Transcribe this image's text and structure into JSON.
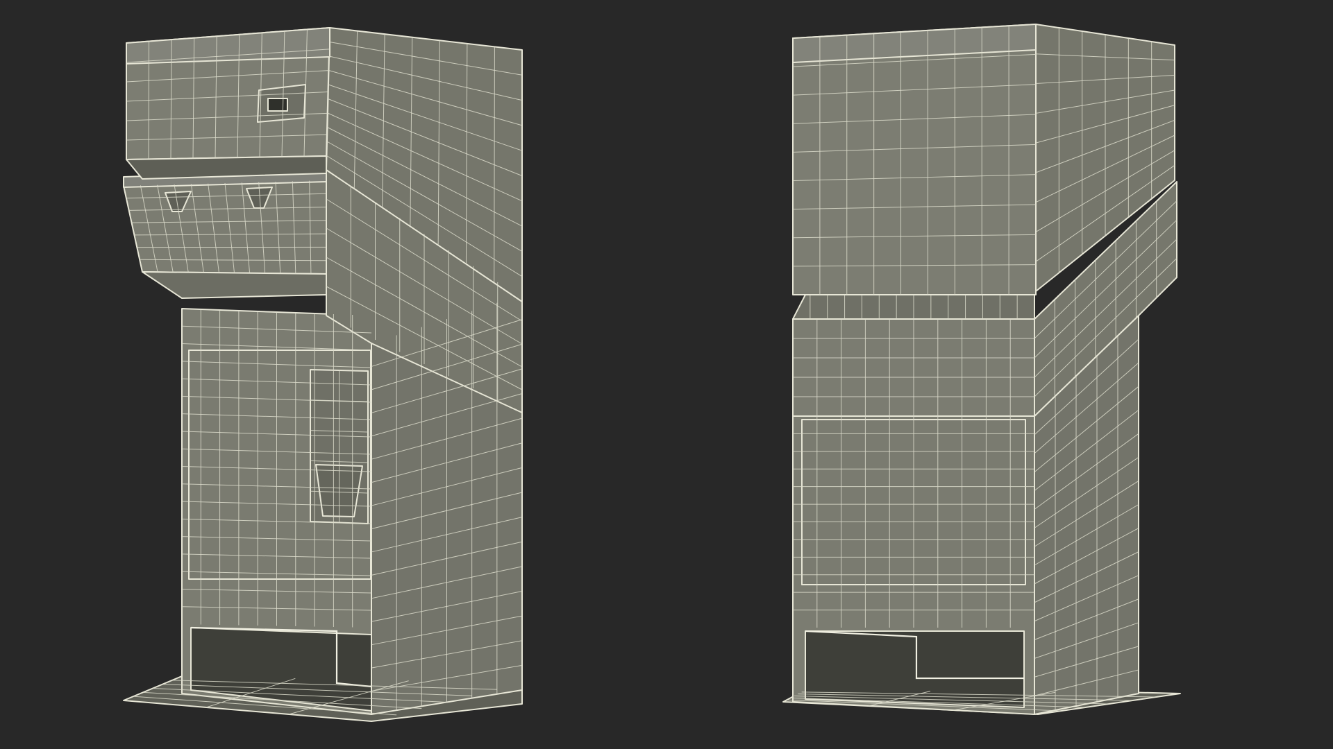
{
  "scene": {
    "background": "#282828",
    "colors": {
      "front_face": "#7a7b6f",
      "side_face": "#737468",
      "dark_face": "#5e5f56",
      "base_plate": "#6a6b61",
      "wire": "#e7e6d6"
    },
    "models": [
      {
        "name": "kiosk-wireframe-front-view"
      },
      {
        "name": "kiosk-wireframe-back-view"
      }
    ]
  }
}
